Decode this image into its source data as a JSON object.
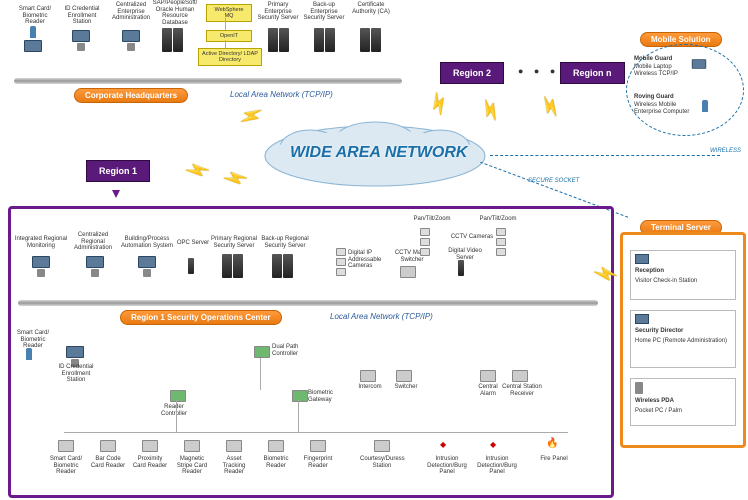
{
  "hq": {
    "title": "Corporate Headquarters",
    "lan": "Local Area Network (TCP/IP)",
    "nodes": {
      "n1": "Smart Card/\nBiometric Reader",
      "n2": "ID Credential\nEnrollment Station",
      "n3": "Centralized\nEnterprise\nAdministration",
      "sap": "SAP/PeopleSoft/\nOracle\nHuman Resource\nDatabase",
      "wsmq": "WebSphere\nMQ",
      "openit": "OpenIT",
      "adldap": "Active Directory/\nLDAP Directory",
      "n5": "Primary\nEnterprise\nSecurity Server",
      "n6": "Back-up\nEnterprise\nSecurity Server",
      "n7": "Certificate\nAuthority (CA)"
    }
  },
  "wan": "WIDE AREA NETWORK",
  "wireless": "WIRELESS",
  "secure": "SECURE SOCKET",
  "region_boxes": {
    "r1": "Region 1",
    "r2": "Region 2",
    "dots": "● ● ●",
    "rn": "Region n"
  },
  "mobile": {
    "title": "Mobile Solution",
    "g1": "Mobile Guard",
    "g1s": "Mobile Laptop\nWireless TCP/IP",
    "g2": "Roving Guard",
    "g2s": "Wireless Mobile\nEnterprise Computer"
  },
  "r1": {
    "title": "Region 1 Security Operations Center",
    "lan": "Local Area Network (TCP/IP)",
    "top": {
      "t1": "Integrated Regional\nMonitoring",
      "t2": "Centralized\nRegional\nAdministration",
      "t3": "Building/Process\nAutomation System",
      "t4": "OPC Server",
      "t5": "Primary Regional\nSecurity Server",
      "t6": "Back-up Regional\nSecurity Server",
      "cam1": "Digital\nIP Addressable\nCameras",
      "cctv": "CCTV\nMatrix Switcher",
      "dvs": "Digital Video\nServer",
      "ptz1": "Pan/Tilt/Zoom",
      "ptz2": "Pan/Tilt/Zoom",
      "cctvcam": "CCTV Cameras"
    },
    "lower": {
      "l1": "Smart Card/\nBiometric Reader",
      "l2": "ID Credential\nEnrollment Station",
      "dual": "Dual Path\nController",
      "rc": "Reader\nController",
      "bg": "Biometric\nGateway",
      "interc": "Intercom",
      "switch": "Switcher",
      "csr": "Central Station\nReceiver",
      "ca": "Central\nAlarm"
    },
    "bottom": {
      "b1": "Smart Card/\nBiometric\nReader",
      "b2": "Bar Code\nCard Reader",
      "b3": "Proximity\nCard Reader",
      "b4": "Magnetic\nStripe Card\nReader",
      "b5": "Asset\nTracking\nReader",
      "b6": "Biometric\nReader",
      "b7": "Fingerprint\nReader",
      "b8": "Courtesy/Duress\nStation",
      "b9": "Intrusion\nDetection/Burg\nPanel",
      "b10": "Intrusion\nDetection/Burg\nPanel",
      "b11": "Fire Panel"
    }
  },
  "terminal": {
    "title": "Terminal Server",
    "i1": "Reception",
    "i1s": "Visitor Check-in\nStation",
    "i2": "Security Director",
    "i2s": "Home PC\n(Remote\nAdministration)",
    "i3": "Wireless PDA",
    "i3s": "Pocket PC / Palm"
  }
}
